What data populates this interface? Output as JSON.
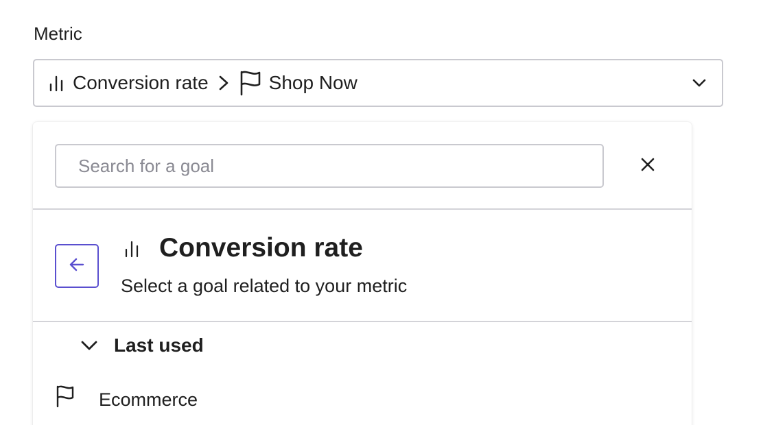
{
  "metric_field": {
    "label": "Metric",
    "selected_metric": "Conversion rate",
    "selected_goal": "Shop Now",
    "metric_icon": "bar-chart-icon",
    "goal_icon": "flag-icon"
  },
  "panel": {
    "search": {
      "placeholder": "Search for a goal",
      "value": ""
    },
    "close_icon": "close-icon",
    "back_icon": "arrow-left-icon",
    "metric_title": "Conversion rate",
    "metric_subtitle": "Select a goal related to your metric",
    "groups": [
      {
        "label": "Last used",
        "expanded": true,
        "items": [
          {
            "label": "Ecommerce",
            "icon": "flag-icon"
          }
        ]
      }
    ]
  },
  "colors": {
    "accent": "#5a4fcf",
    "border": "#c9c9cf",
    "divider": "#d3d3d8",
    "text": "#1f1f1f",
    "placeholder": "#8a8a93"
  }
}
